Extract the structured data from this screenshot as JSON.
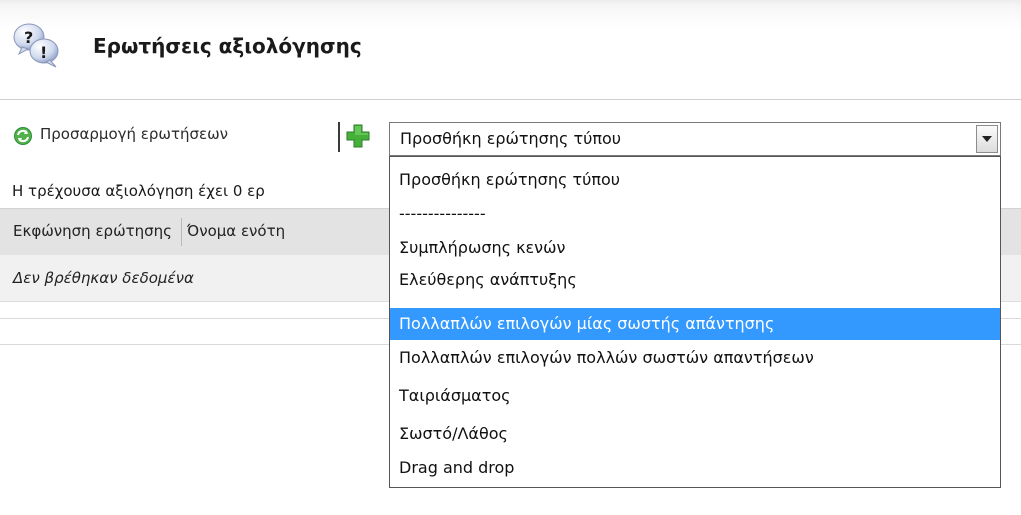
{
  "page": {
    "title": "Ερωτήσεις αξιολόγησης",
    "header_icon": "help-question-bubbles-icon"
  },
  "toolbar": {
    "customize_label": "Προσαρμογή ερωτήσεων",
    "customize_icon": "recycle-refresh-icon",
    "add_icon": "green-plus-icon",
    "question_type_select": {
      "selected_value": "Προσθήκη ερώτησης τύπου",
      "open": true,
      "options": [
        "Προσθήκη ερώτησης τύπου",
        "---------------",
        "Συμπλήρωσης κενών",
        "Ελεύθερης ανάπτυξης",
        "Πολλαπλών επιλογών μίας σωστής απάντησης",
        "Πολλαπλών επιλογών πολλών σωστών απαντήσεων",
        "Ταιριάσματος",
        "Σωστό/Λάθος",
        "Drag and drop"
      ],
      "highlighted_option": "Πολλαπλών επιλογών μίας σωστής απάντησης"
    }
  },
  "info": {
    "text": "Η τρέχουσα αξιολόγηση έχει 0 ερ"
  },
  "grid": {
    "columns": [
      "Εκφώνηση ερώτησης",
      "Όνομα ενότη"
    ],
    "empty_message": "Δεν βρέθηκαν δεδομένα"
  },
  "colors": {
    "highlight": "#3399ff",
    "header_bg": "#e3e3e3",
    "row_bg": "#f1f1f1",
    "plus_green": "#44b03a"
  }
}
